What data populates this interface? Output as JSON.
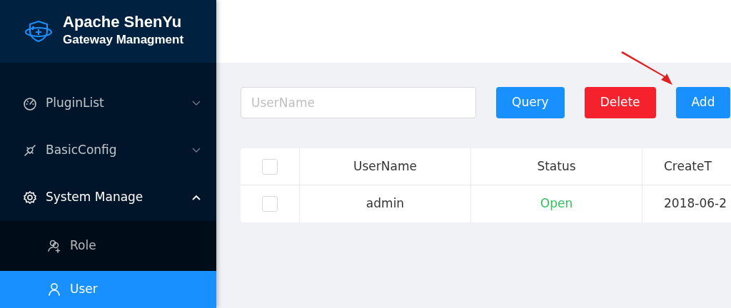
{
  "brand": {
    "title": "Apache ShenYu",
    "subtitle": "Gateway Managment"
  },
  "menu": [
    {
      "label": "PluginList",
      "expanded": false
    },
    {
      "label": "BasicConfig",
      "expanded": false
    },
    {
      "label": "System Manage",
      "expanded": true,
      "children": [
        {
          "label": "Role",
          "selected": false
        },
        {
          "label": "User",
          "selected": true
        }
      ]
    }
  ],
  "search": {
    "placeholder": "UserName"
  },
  "buttons": [
    {
      "label": "Query",
      "kind": "primary"
    },
    {
      "label": "Delete",
      "kind": "danger"
    },
    {
      "label": "Add",
      "kind": "primary"
    }
  ],
  "table": {
    "header_checked": false,
    "columns": [
      "UserName",
      "Status",
      "CreateT"
    ],
    "rows": [
      {
        "checked": false,
        "username": "admin",
        "status": "Open",
        "enabled": true,
        "created": "2018-06-2"
      }
    ]
  }
}
